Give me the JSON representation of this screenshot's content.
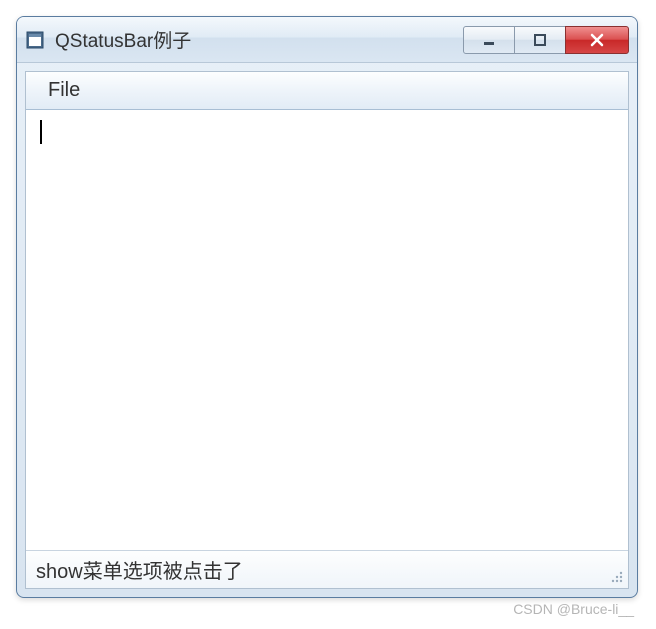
{
  "window": {
    "title": "QStatusBar例子"
  },
  "menubar": {
    "items": [
      {
        "label": "File"
      }
    ]
  },
  "content": {
    "text": ""
  },
  "statusbar": {
    "message": "show菜单选项被点击了"
  },
  "watermark": "CSDN @Bruce-li__"
}
